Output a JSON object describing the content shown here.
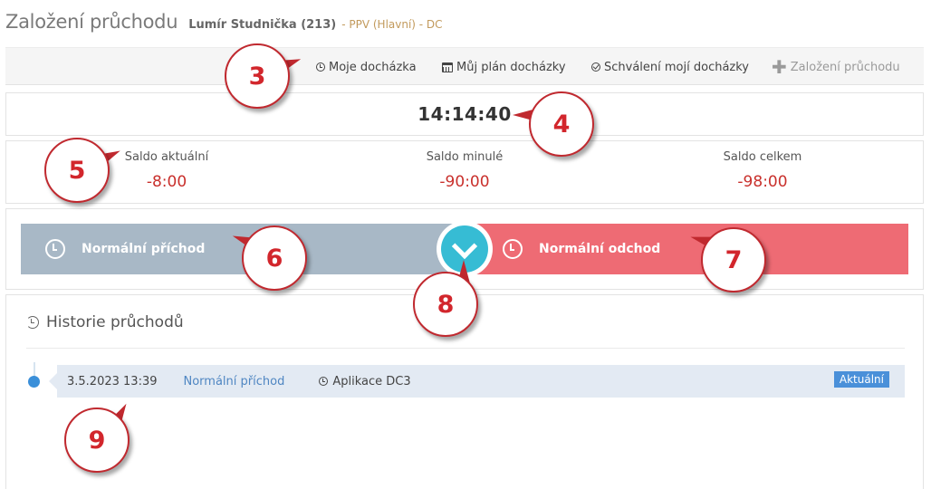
{
  "header": {
    "title": "Založení průchodu",
    "user": "Lumír Studnička (213)",
    "meta": "- PPV (Hlavní) - DC"
  },
  "toolbar": {
    "items": [
      {
        "label": "Moje docházka",
        "icon": "clock-icon"
      },
      {
        "label": "Můj plán docházky",
        "icon": "calendar-icon"
      },
      {
        "label": "Schválení mojí docházky",
        "icon": "check-circle-icon"
      },
      {
        "label": "Založení průchodu",
        "icon": "plus-icon",
        "state": "disabled"
      }
    ]
  },
  "clock": {
    "time": "14:14:40"
  },
  "saldo": [
    {
      "label": "Saldo aktuální",
      "value": "-8:00"
    },
    {
      "label": "Saldo minulé",
      "value": "-90:00"
    },
    {
      "label": "Saldo celkem",
      "value": "-98:00"
    }
  ],
  "actions": {
    "arrival": {
      "label": "Normální příchod",
      "color": "#a8b8c6"
    },
    "departure": {
      "label": "Normální odchod",
      "color": "#ee6b74"
    },
    "confirm_icon": "chevron-down-icon"
  },
  "history": {
    "title": "Historie průchodů",
    "entries": [
      {
        "time": "3.5.2023 13:39",
        "type": "Normální příchod",
        "source": "Aplikace DC3",
        "badge": "Aktuální"
      }
    ]
  },
  "callouts": [
    "3",
    "4",
    "5",
    "6",
    "7",
    "8",
    "9"
  ],
  "colors": {
    "accent": "#36bcd4",
    "negative": "#c9302c",
    "callout": "#d2262c"
  }
}
